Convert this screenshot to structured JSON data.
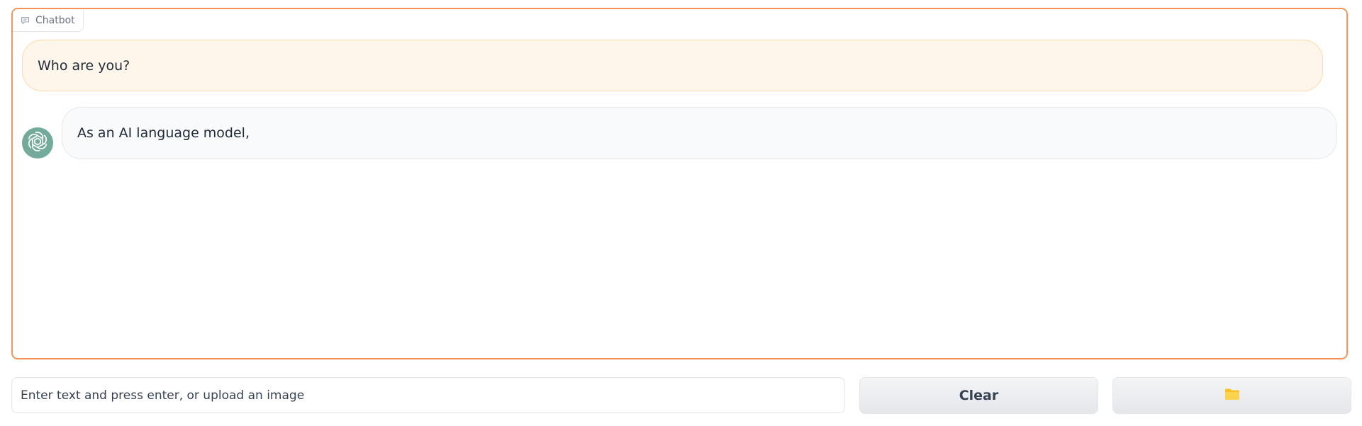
{
  "chatbot": {
    "label": "Chatbot",
    "label_icon": "chat-bubble-icon",
    "messages": [
      {
        "role": "user",
        "text": "Who are you?"
      },
      {
        "role": "assistant",
        "avatar": "openai-logo-icon",
        "text": "As an AI language model,"
      }
    ]
  },
  "input": {
    "placeholder": "Enter text and press enter, or upload an image",
    "value": ""
  },
  "buttons": {
    "clear_label": "Clear",
    "upload_label": "📁",
    "upload_icon": "folder-icon"
  },
  "colors": {
    "accent_border": "#f4935a",
    "user_bubble": "#fff6eb",
    "bot_bubble": "#f9fafb",
    "avatar_bg": "#74aa9c",
    "folder": "#fbbf24"
  }
}
